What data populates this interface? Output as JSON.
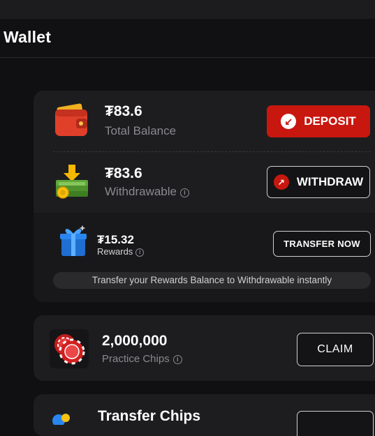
{
  "header": {
    "title": "Wallet"
  },
  "balance_card": {
    "total": {
      "currency_symbol": "₮",
      "amount": "₮83.6",
      "label": "Total Balance"
    },
    "deposit_button": {
      "label": "DEPOSIT",
      "icon": "arrow-down-left-icon"
    },
    "withdrawable": {
      "amount": "₮83.6",
      "label": "Withdrawable"
    },
    "withdraw_button": {
      "label": "WITHDRAW",
      "icon": "arrow-up-right-icon"
    },
    "rewards": {
      "amount": "₮15.32",
      "label": "Rewards",
      "transfer_button": "TRANSFER NOW",
      "hint": "Transfer your Rewards Balance to Withdrawable instantly"
    }
  },
  "chips_card": {
    "amount": "2,000,000",
    "label": "Practice Chips",
    "claim_button": "CLAIM"
  },
  "transfer_card": {
    "title": "Transfer Chips"
  },
  "colors": {
    "accent_red": "#c8170f",
    "card_bg": "#1d1d20",
    "page_bg": "#101012",
    "muted_text": "#8a8a8e"
  }
}
